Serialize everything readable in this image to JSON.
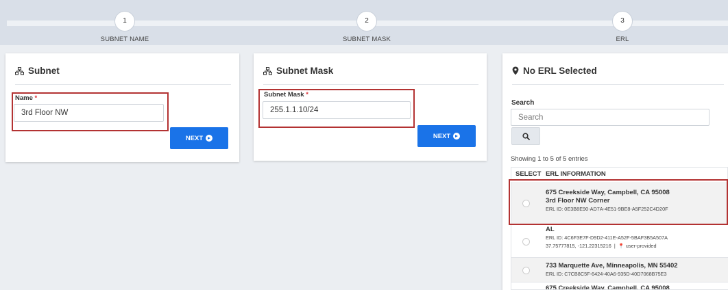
{
  "stepper": {
    "steps": [
      {
        "number": "1",
        "label": "SUBNET NAME"
      },
      {
        "number": "2",
        "label": "SUBNET MASK"
      },
      {
        "number": "3",
        "label": "ERL"
      }
    ]
  },
  "subnet_card": {
    "title": "Subnet",
    "name_label": "Name",
    "required_mark": "*",
    "name_value": "3rd Floor NW",
    "next_label": "NEXT"
  },
  "mask_card": {
    "title": "Subnet Mask",
    "mask_label": "Subnet Mask",
    "required_mark": "*",
    "mask_value": "255.1.1.10/24",
    "next_label": "NEXT"
  },
  "erl_card": {
    "title": "No ERL Selected",
    "search_label": "Search",
    "search_placeholder": "Search",
    "entries_text": "Showing 1 to 5 of 5 entries",
    "columns": {
      "select": "SELECT",
      "info": "ERL INFORMATION"
    },
    "rows": [
      {
        "line1": "675 Creekside Way, Campbell, CA 95008",
        "line2": "3rd Floor NW Corner",
        "erl_id": "ERL ID: 0E3B8E90-AD7A-4E51-9BE8-A5F252C4D20F"
      },
      {
        "line1": "AL",
        "erl_id": "ERL ID: 4C6F3E7F-D9D2-411E-A52F-5BAF3B5A507A",
        "coords": "37.75777815, -121.22315216",
        "separator": "|",
        "provided": "user-provided"
      },
      {
        "line1": "733 Marquette Ave, Minneapolis, MN 55402",
        "erl_id": "ERL ID: C7CB8C5F-6424-40A6-935D-40D7068B75E3"
      },
      {
        "line1": "675 Creekside Way, Campbell, CA 95008"
      }
    ]
  },
  "colors": {
    "accent": "#1a73e8",
    "highlight": "#b33232",
    "required": "#d9343a"
  }
}
